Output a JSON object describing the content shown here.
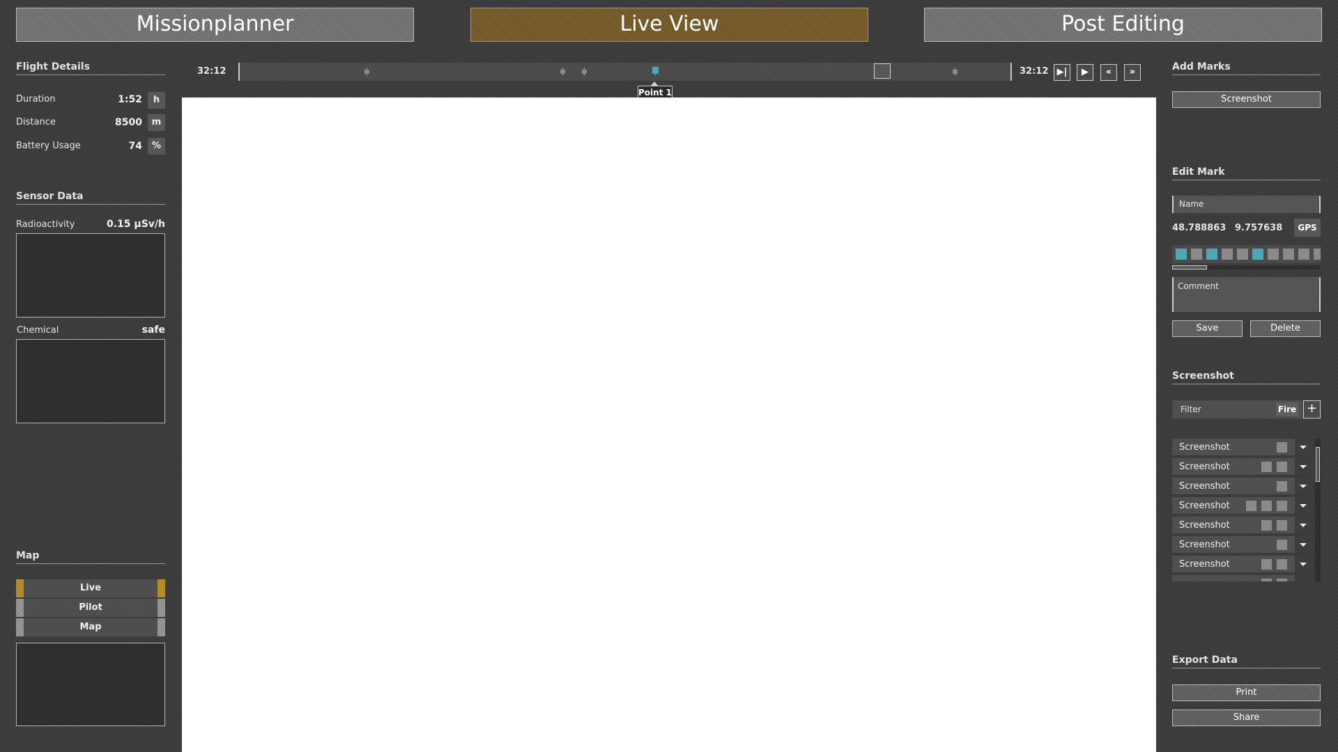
{
  "tabs": [
    {
      "label": "Missionplanner",
      "active": false
    },
    {
      "label": "Live View",
      "active": true
    },
    {
      "label": "Post Editing",
      "active": false
    }
  ],
  "flight_details": {
    "title": "Flight Details",
    "rows": [
      {
        "label": "Duration",
        "value": "1:52",
        "unit": "h"
      },
      {
        "label": "Distance",
        "value": "8500",
        "unit": "m"
      },
      {
        "label": "Battery Usage",
        "value": "74",
        "unit": "%"
      }
    ]
  },
  "sensor_data": {
    "title": "Sensor Data",
    "radioactivity": {
      "label": "Radioactivity",
      "value": "0.15 µSv/h"
    },
    "chemical": {
      "label": "Chemical",
      "value": "safe"
    }
  },
  "map": {
    "title": "Map",
    "options": [
      {
        "label": "Live",
        "active": true
      },
      {
        "label": "Pilot",
        "active": false
      },
      {
        "label": "Map",
        "active": false
      }
    ]
  },
  "timeline": {
    "start_time": "32:12",
    "end_time": "32:12",
    "marker_label": "Point 1",
    "controls": [
      "skip-to-end",
      "play",
      "rewind",
      "fast-forward"
    ]
  },
  "add_marks": {
    "title": "Add Marks",
    "button_label": "Screenshot"
  },
  "edit_mark": {
    "title": "Edit Mark",
    "name_placeholder": "Name",
    "latitude": "48.788863",
    "longitude": "9.757638",
    "gps_label": "GPS",
    "comment_placeholder": "Comment",
    "save_label": "Save",
    "delete_label": "Delete"
  },
  "screenshot_panel": {
    "title": "Screenshot",
    "filter_label": "Filter",
    "filter_tag": "Fire",
    "add_label": "+",
    "items": [
      {
        "label": "Screenshot",
        "marks": 1
      },
      {
        "label": "Screenshot",
        "marks": 2
      },
      {
        "label": "Screenshot",
        "marks": 1
      },
      {
        "label": "Screenshot",
        "marks": 3
      },
      {
        "label": "Screenshot",
        "marks": 2
      },
      {
        "label": "Screenshot",
        "marks": 1
      },
      {
        "label": "Screenshot",
        "marks": 2
      }
    ]
  },
  "export_data": {
    "title": "Export Data",
    "print_label": "Print",
    "share_label": "Share"
  },
  "colors": {
    "accent": "#b58a2b",
    "marker": "#4fa6b5",
    "background": "#3a3a3a"
  }
}
